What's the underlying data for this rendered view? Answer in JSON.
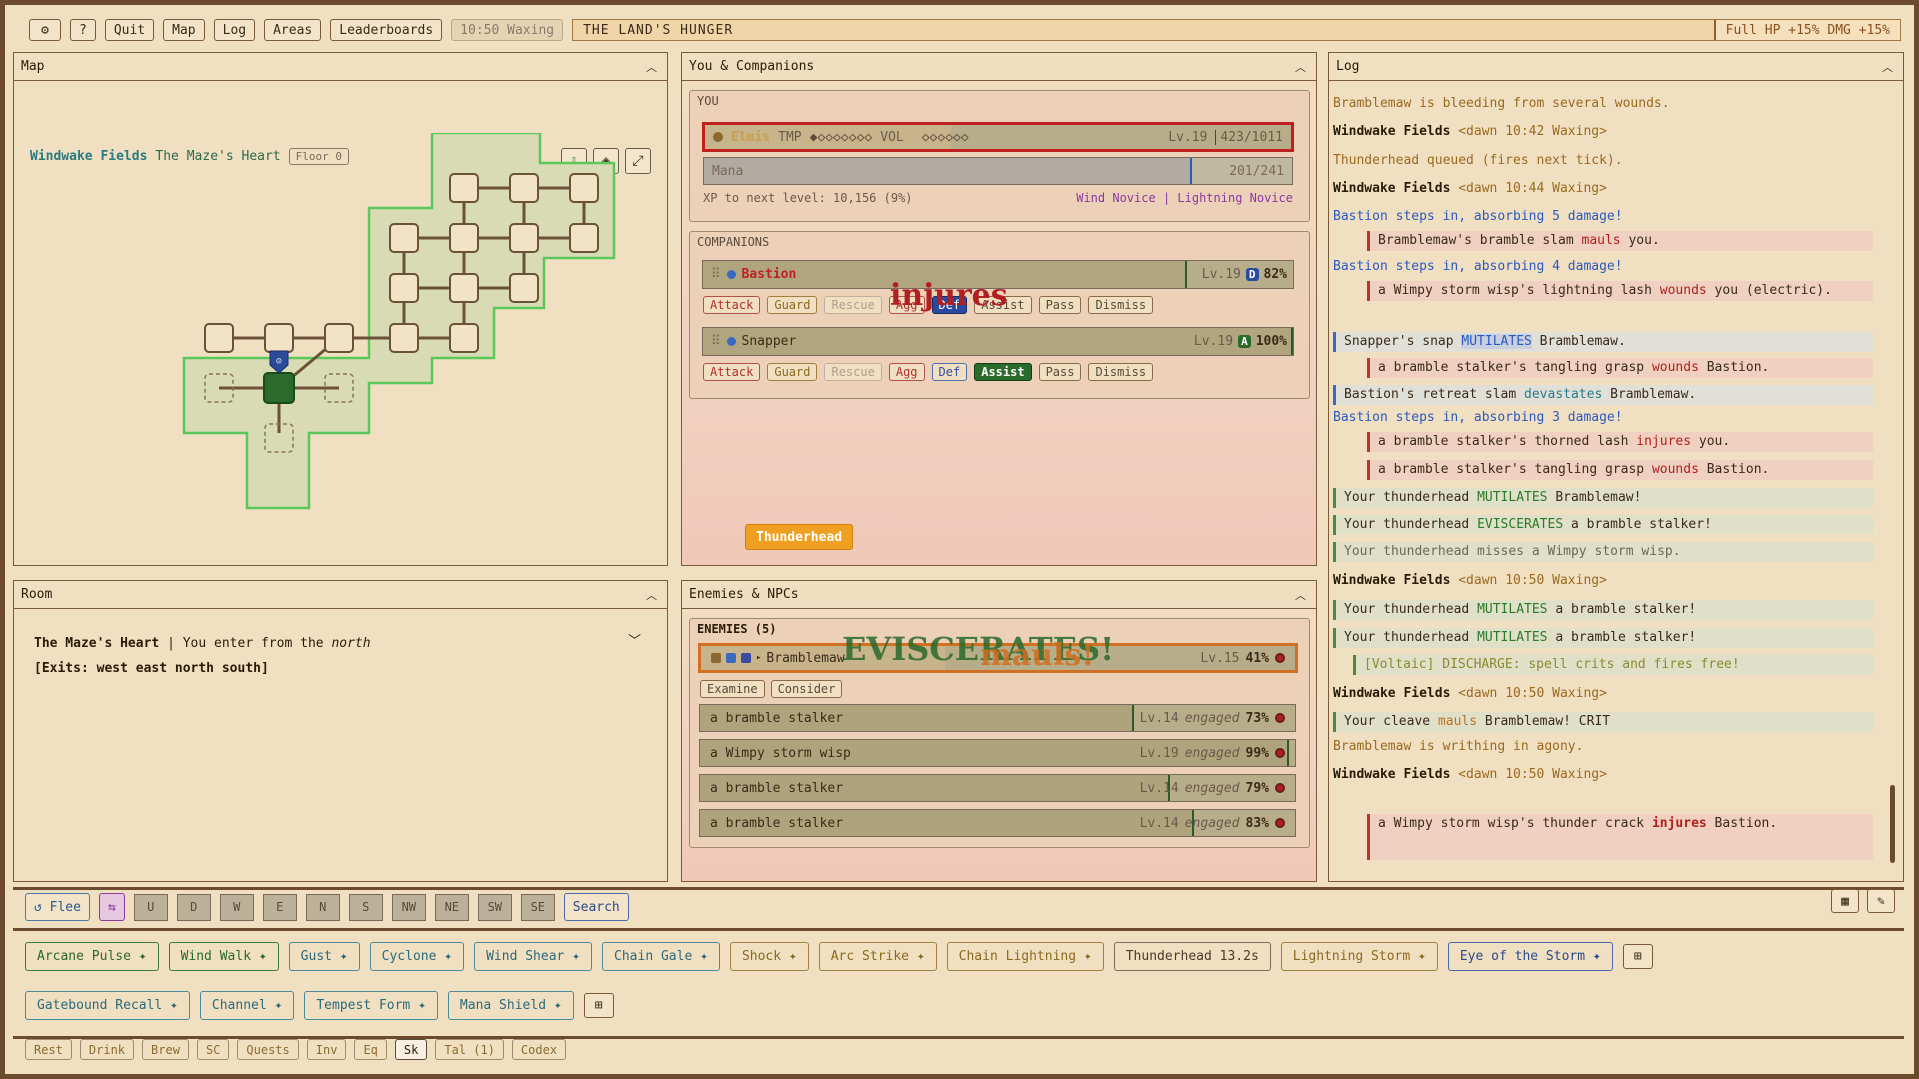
{
  "topbar": {
    "settings_icon": "gear-icon",
    "help": "?",
    "quit": "Quit",
    "map": "Map",
    "log": "Log",
    "areas": "Areas",
    "leaderboards": "Leaderboards",
    "time": "10:50 Waxing",
    "land_title": "THE LAND'S HUNGER",
    "land_bonus": "Full HP +15% DMG +15%"
  },
  "map": {
    "title": "Map",
    "zone": "Windwake Fields",
    "room": "The Maze's Heart",
    "floor": "Floor 0",
    "icons": [
      "recall-icon",
      "tag-icon",
      "expand-icon"
    ]
  },
  "companions_panel": {
    "title": "You & Companions",
    "you_label": "YOU",
    "player": {
      "name": "Elmis",
      "tmp_label": "TMP",
      "tmp_pips": "◆◇◇◇◇◇◇◇",
      "vol_label": "VOL",
      "vol_pips": "◇◇◇◇◇◇",
      "level": "Lv.19",
      "hp": "423/1011",
      "hp_fraction": 0.42
    },
    "mana": {
      "label": "Mana",
      "value": "201/241",
      "fraction": 0.83
    },
    "xp": "XP to next level: 10,156 (9%)",
    "titles": [
      "Wind Novice",
      "Lightning Novice"
    ],
    "titles_sep": "|",
    "companions_label": "COMPANIONS",
    "companions": [
      {
        "name": "Bastion",
        "level": "Lv.19",
        "stance": "D",
        "hp": "82%",
        "hp_fraction": 0.82
      },
      {
        "name": "Snapper",
        "level": "Lv.19",
        "stance": "A",
        "hp": "100%",
        "hp_fraction": 1.0
      }
    ],
    "actions": [
      "Attack",
      "Guard",
      "Rescue",
      "Agg",
      "Def",
      "Assist",
      "Pass",
      "Dismiss"
    ],
    "floating": "injures",
    "queued": "Thunderhead"
  },
  "enemies_panel": {
    "title": "Enemies & NPCs",
    "label": "ENEMIES (5)",
    "target": {
      "name": "Bramblemaw",
      "level": "Lv.15",
      "hp": "41%",
      "hp_fraction": 0.41
    },
    "examine": "Examine",
    "consider": "Consider",
    "list": [
      {
        "name": "a bramble stalker",
        "level": "Lv.14",
        "state": "engaged",
        "hp": "73%",
        "hp_fraction": 0.73
      },
      {
        "name": "a Wimpy storm wisp",
        "level": "Lv.19",
        "state": "engaged",
        "hp": "99%",
        "hp_fraction": 0.99
      },
      {
        "name": "a bramble stalker",
        "level": "Lv.14",
        "state": "engaged",
        "hp": "79%",
        "hp_fraction": 0.79
      },
      {
        "name": "a bramble stalker",
        "level": "Lv.14",
        "state": "engaged",
        "hp": "83%",
        "hp_fraction": 0.83
      }
    ],
    "floating1": "EVISCERATES!",
    "floating2": "mauls!"
  },
  "room": {
    "title": "Room",
    "name": "The Maze's Heart",
    "sep": "|",
    "enter": "You enter from the",
    "dir": "north",
    "exits": "[Exits: west east north south]"
  },
  "log": {
    "title": "Log"
  },
  "bottom": {
    "flee": "Flee",
    "dirs": [
      "U",
      "D",
      "W",
      "E",
      "N",
      "S",
      "NW",
      "NE",
      "SW",
      "SE"
    ],
    "search": "Search",
    "skills1": [
      "Arcane Pulse ✦",
      "Wind Walk ✦",
      "Gust ✦",
      "Cyclone ✦",
      "Wind Shear ✦",
      "Chain Gale ✦",
      "Shock ✦",
      "Arc Strike ✦",
      "Chain Lightning ✦",
      "Thunderhead 13.2s",
      "Lightning Storm ✦",
      "Eye of the Storm ✦"
    ],
    "skills2": [
      "Gatebound Recall ✦",
      "Channel ✦",
      "Tempest Form ✦",
      "Mana Shield ✦"
    ],
    "tabs": [
      "Rest",
      "Drink",
      "Brew",
      "SC",
      "Quests",
      "Inv",
      "Eq",
      "Sk",
      "Tal (1)",
      "Codex"
    ]
  },
  "colors": {
    "accent": "#2a6a2a",
    "danger": "#b02020",
    "frame": "#6b4a2e"
  }
}
